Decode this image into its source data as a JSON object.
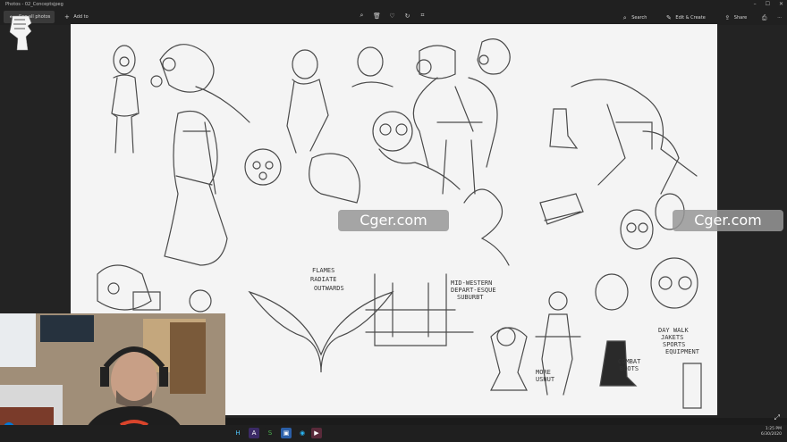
{
  "window": {
    "title": "Photos - 02_Conceptsjpeg",
    "controls": [
      "–",
      "☐",
      "✕"
    ]
  },
  "toolbar": {
    "all_photos_label": "See all photos",
    "add_to_label": "Add to",
    "center_icons": [
      "zoom-icon",
      "delete-icon",
      "favorite-icon",
      "rotate-icon",
      "crop-icon"
    ],
    "search_label": "Search",
    "edit_create_label": "Edit & Create",
    "share_label": "Share",
    "more_label": "···"
  },
  "sketch": {
    "annotations": {
      "flames": "FLAMES",
      "radiate": "RADIATE",
      "outwards": "OUTWARDS",
      "mid_western_1": "MID-WESTERN",
      "mid_western_2": "DEPART-ESQUE",
      "mid_western_3": "SUBURBT",
      "more_ushut": "MORE",
      "ushut": "USHUT",
      "day_walk_1": "DAY WALK",
      "day_walk_2": "JAKETS",
      "day_walk_3": "SPORTS",
      "day_walk_4": "EQUIPMENT",
      "combat_1": "COMBAT",
      "combat_2": "BOOTS"
    }
  },
  "watermarks": [
    "Cger.com",
    "Cger.com"
  ],
  "taskbar": {
    "apps": [
      "H",
      "A",
      "S",
      "▣",
      "◉",
      "▶"
    ],
    "time": "1:25 PM",
    "date": "6/30/2020"
  },
  "colors": {
    "accent": "#0078d7",
    "sheet": "#f3f3f3",
    "chrome": "#202020"
  }
}
